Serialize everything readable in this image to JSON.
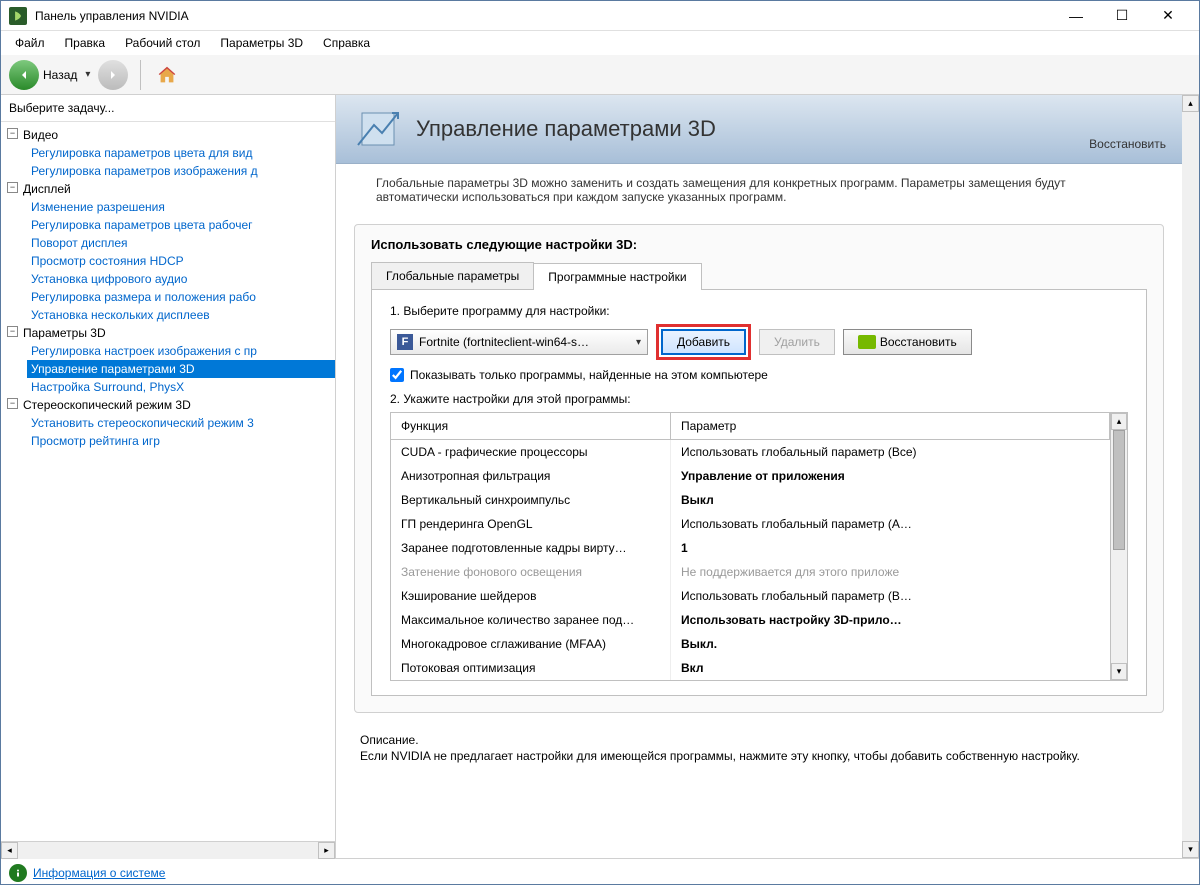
{
  "window": {
    "title": "Панель управления NVIDIA"
  },
  "menu": {
    "file": "Файл",
    "edit": "Правка",
    "desktop": "Рабочий стол",
    "params3d": "Параметры 3D",
    "help": "Справка"
  },
  "toolbar": {
    "back_label": "Назад"
  },
  "sidebar": {
    "header": "Выберите задачу...",
    "groups": [
      {
        "label": "Видео",
        "items": [
          "Регулировка параметров цвета для вид",
          "Регулировка параметров изображения д"
        ]
      },
      {
        "label": "Дисплей",
        "items": [
          "Изменение разрешения",
          "Регулировка параметров цвета рабочег",
          "Поворот дисплея",
          "Просмотр состояния HDCP",
          "Установка цифрового аудио",
          "Регулировка размера и положения рабо",
          "Установка нескольких дисплеев"
        ]
      },
      {
        "label": "Параметры 3D",
        "items": [
          "Регулировка настроек изображения с пр",
          "Управление параметрами 3D",
          "Настройка Surround, PhysX"
        ],
        "selected_index": 1
      },
      {
        "label": "Стереоскопический режим 3D",
        "items": [
          "Установить стереоскопический режим 3",
          "Просмотр рейтинга игр"
        ]
      }
    ]
  },
  "content": {
    "title": "Управление параметрами 3D",
    "restore": "Восстановить",
    "restore_btn": "Восстановить",
    "desc": "Глобальные параметры 3D можно заменить и создать замещения для конкретных программ. Параметры замещения будут автоматически использоваться при каждом запуске указанных программ.",
    "box_title": "Использовать следующие настройки 3D:",
    "tabs": {
      "global": "Глобальные параметры",
      "program": "Программные настройки"
    },
    "step1": "1. Выберите программу для настройки:",
    "program_selected": "Fortnite (fortniteclient-win64-s…",
    "add_btn": "Добавить",
    "remove_btn": "Удалить",
    "show_only_checkbox": "Показывать только программы, найденные на этом компьютере",
    "step2": "2. Укажите настройки для этой программы:",
    "table_headers": {
      "func": "Функция",
      "param": "Параметр"
    },
    "settings": [
      {
        "func": "CUDA - графические процессоры",
        "param": "Использовать глобальный параметр (Все)",
        "bold": false,
        "disabled": false
      },
      {
        "func": "Анизотропная фильтрация",
        "param": "Управление от приложения",
        "bold": true,
        "disabled": false
      },
      {
        "func": "Вертикальный синхроимпульс",
        "param": "Выкл",
        "bold": true,
        "disabled": false
      },
      {
        "func": "ГП рендеринга OpenGL",
        "param": "Использовать глобальный параметр (A…",
        "bold": false,
        "disabled": false
      },
      {
        "func": "Заранее подготовленные кадры вирту…",
        "param": "1",
        "bold": true,
        "disabled": false
      },
      {
        "func": "Затенение фонового освещения",
        "param": "Не поддерживается для этого приложе",
        "bold": false,
        "disabled": true
      },
      {
        "func": "Кэширование шейдеров",
        "param": "Использовать глобальный параметр (В…",
        "bold": false,
        "disabled": false
      },
      {
        "func": "Максимальное количество заранее под…",
        "param": "Использовать настройку 3D-прило…",
        "bold": true,
        "disabled": false
      },
      {
        "func": "Многокадровое сглаживание (MFAA)",
        "param": "Выкл.",
        "bold": true,
        "disabled": false
      },
      {
        "func": "Потоковая оптимизация",
        "param": "Вкл",
        "bold": true,
        "disabled": false
      }
    ],
    "description_title": "Описание.",
    "description_body": "Если NVIDIA не предлагает настройки для имеющейся программы, нажмите эту кнопку, чтобы добавить собственную настройку."
  },
  "statusbar": {
    "sysinfo": "Информация о системе"
  }
}
